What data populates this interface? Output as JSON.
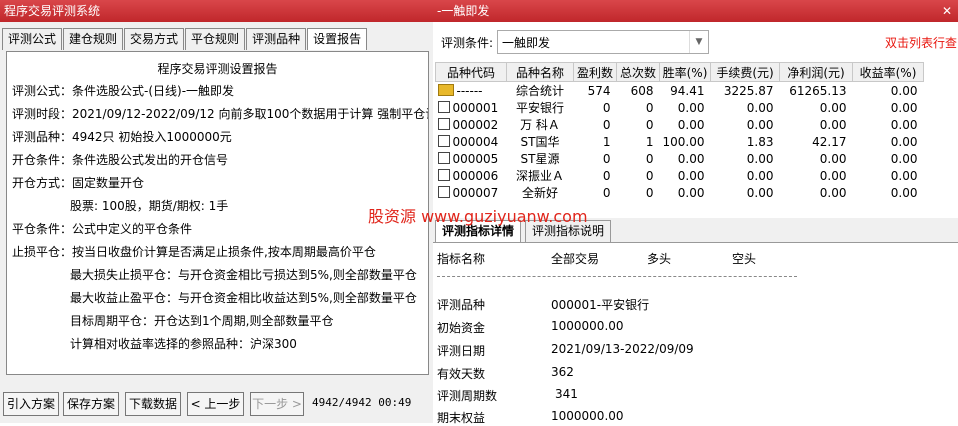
{
  "left_window": {
    "title": "程序交易评测系统",
    "tabs": [
      "评测公式",
      "建仓规则",
      "交易方式",
      "平仓规则",
      "评测品种",
      "设置报告"
    ],
    "active_tab": 5,
    "report": {
      "title": "程序交易评测设置报告",
      "lines": [
        "评测公式：条件选股公式-(日线)-一触即发",
        "评测时段：2021/09/12-2022/09/12 向前多取100个数据用于计算 强制平仓计入",
        "评测品种：4942只 初始投入1000000元",
        "开仓条件：条件选股公式发出的开仓信号",
        "开仓方式：固定数量开仓",
        "股票: 100股，期货/期权: 1手",
        "平仓条件：公式中定义的平仓条件",
        "止损平仓：按当日收盘价计算是否满足止损条件,按本周期最高价平仓",
        "最大损失止损平仓：与开仓资金相比亏损达到5%,则全部数量平仓",
        "最大收益止盈平仓：与开仓资金相比收益达到5%,则全部数量平仓",
        "目标周期平仓：开仓达到1个周期,则全部数量平仓",
        "计算相对收益率选择的参照品种：沪深300"
      ]
    },
    "buttons": {
      "import": "引入方案",
      "save": "保存方案",
      "download": "下载数据",
      "prev": "< 上一步",
      "next": "下一步 >"
    },
    "status": "4942/4942 00:49"
  },
  "right_window": {
    "title": "-一触即发",
    "close_icon": "close-icon",
    "condition_label": "评测条件:",
    "condition_value": "一触即发",
    "hint": "双击列表行查",
    "columns": [
      "品种代码",
      "品种名称",
      "盈利数",
      "总次数",
      "胜率(%)",
      "手续费(元)",
      "净利润(元)",
      "收益率(%)"
    ],
    "rows": [
      {
        "code": "------",
        "name": "综合统计",
        "wins": "574",
        "total": "608",
        "rate": "94.41",
        "fee": "3225.87",
        "profit": "61265.13",
        "ret": "0.00",
        "icon": "folder-icon"
      },
      {
        "code": "000001",
        "name": "平安银行",
        "wins": "0",
        "total": "0",
        "rate": "0.00",
        "fee": "0.00",
        "profit": "0.00",
        "ret": "0.00",
        "icon": "document-icon"
      },
      {
        "code": "000002",
        "name": "万 科Ａ",
        "wins": "0",
        "total": "0",
        "rate": "0.00",
        "fee": "0.00",
        "profit": "0.00",
        "ret": "0.00",
        "icon": "document-icon"
      },
      {
        "code": "000004",
        "name": "ST国华",
        "wins": "1",
        "total": "1",
        "rate": "100.00",
        "fee": "1.83",
        "profit": "42.17",
        "ret": "0.00",
        "icon": "document-icon"
      },
      {
        "code": "000005",
        "name": "ST星源",
        "wins": "0",
        "total": "0",
        "rate": "0.00",
        "fee": "0.00",
        "profit": "0.00",
        "ret": "0.00",
        "icon": "document-icon"
      },
      {
        "code": "000006",
        "name": "深振业Ａ",
        "wins": "0",
        "total": "0",
        "rate": "0.00",
        "fee": "0.00",
        "profit": "0.00",
        "ret": "0.00",
        "icon": "document-icon"
      },
      {
        "code": "000007",
        "name": "全新好",
        "wins": "0",
        "total": "0",
        "rate": "0.00",
        "fee": "0.00",
        "profit": "0.00",
        "ret": "0.00",
        "icon": "document-icon"
      }
    ],
    "sub_tabs": [
      "评测指标详情",
      "评测指标说明"
    ],
    "detail_header": [
      "指标名称",
      "全部交易",
      "多头",
      "空头"
    ],
    "details": [
      {
        "label": "评测品种",
        "value": "000001-平安银行"
      },
      {
        "label": "初始资金",
        "value": "1000000.00"
      },
      {
        "label": "评测日期",
        "value": "2021/09/13-2022/09/09"
      },
      {
        "label": "有效天数",
        "value": "362"
      },
      {
        "label": "评测周期数",
        "value": "341"
      },
      {
        "label": "期末权益",
        "value": "1000000.00"
      }
    ]
  },
  "watermark": "股资源 www.guziyuanw.com",
  "colors": {
    "titlebar": "#c92d31",
    "hint": "#e8160e",
    "watermark": "#e0251b"
  }
}
